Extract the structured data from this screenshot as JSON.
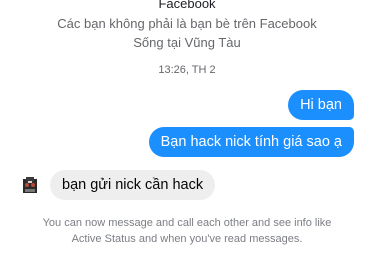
{
  "header": {
    "platform": "Facebook",
    "relation": "Các bạn không phải là bạn bè trên Facebook",
    "lives_in": "Sống tại Vũng Tàu"
  },
  "timestamp": "13:26, TH 2",
  "messages": [
    {
      "direction": "outgoing",
      "text": "Hi bạn"
    },
    {
      "direction": "outgoing",
      "text": "Bạn hack nick tính giá sao ạ"
    },
    {
      "direction": "incoming",
      "text": "bạn gửi nick cần hack"
    }
  ],
  "notice": {
    "line1": "You can now message and call each other and see info like",
    "line2": "Active Status and when you've read messages."
  },
  "colors": {
    "outgoing_bubble": "#1c8fff",
    "incoming_bubble": "#eeeeee",
    "secondary_text": "#65676b"
  },
  "icons": {
    "contact_avatar": "avatar"
  }
}
